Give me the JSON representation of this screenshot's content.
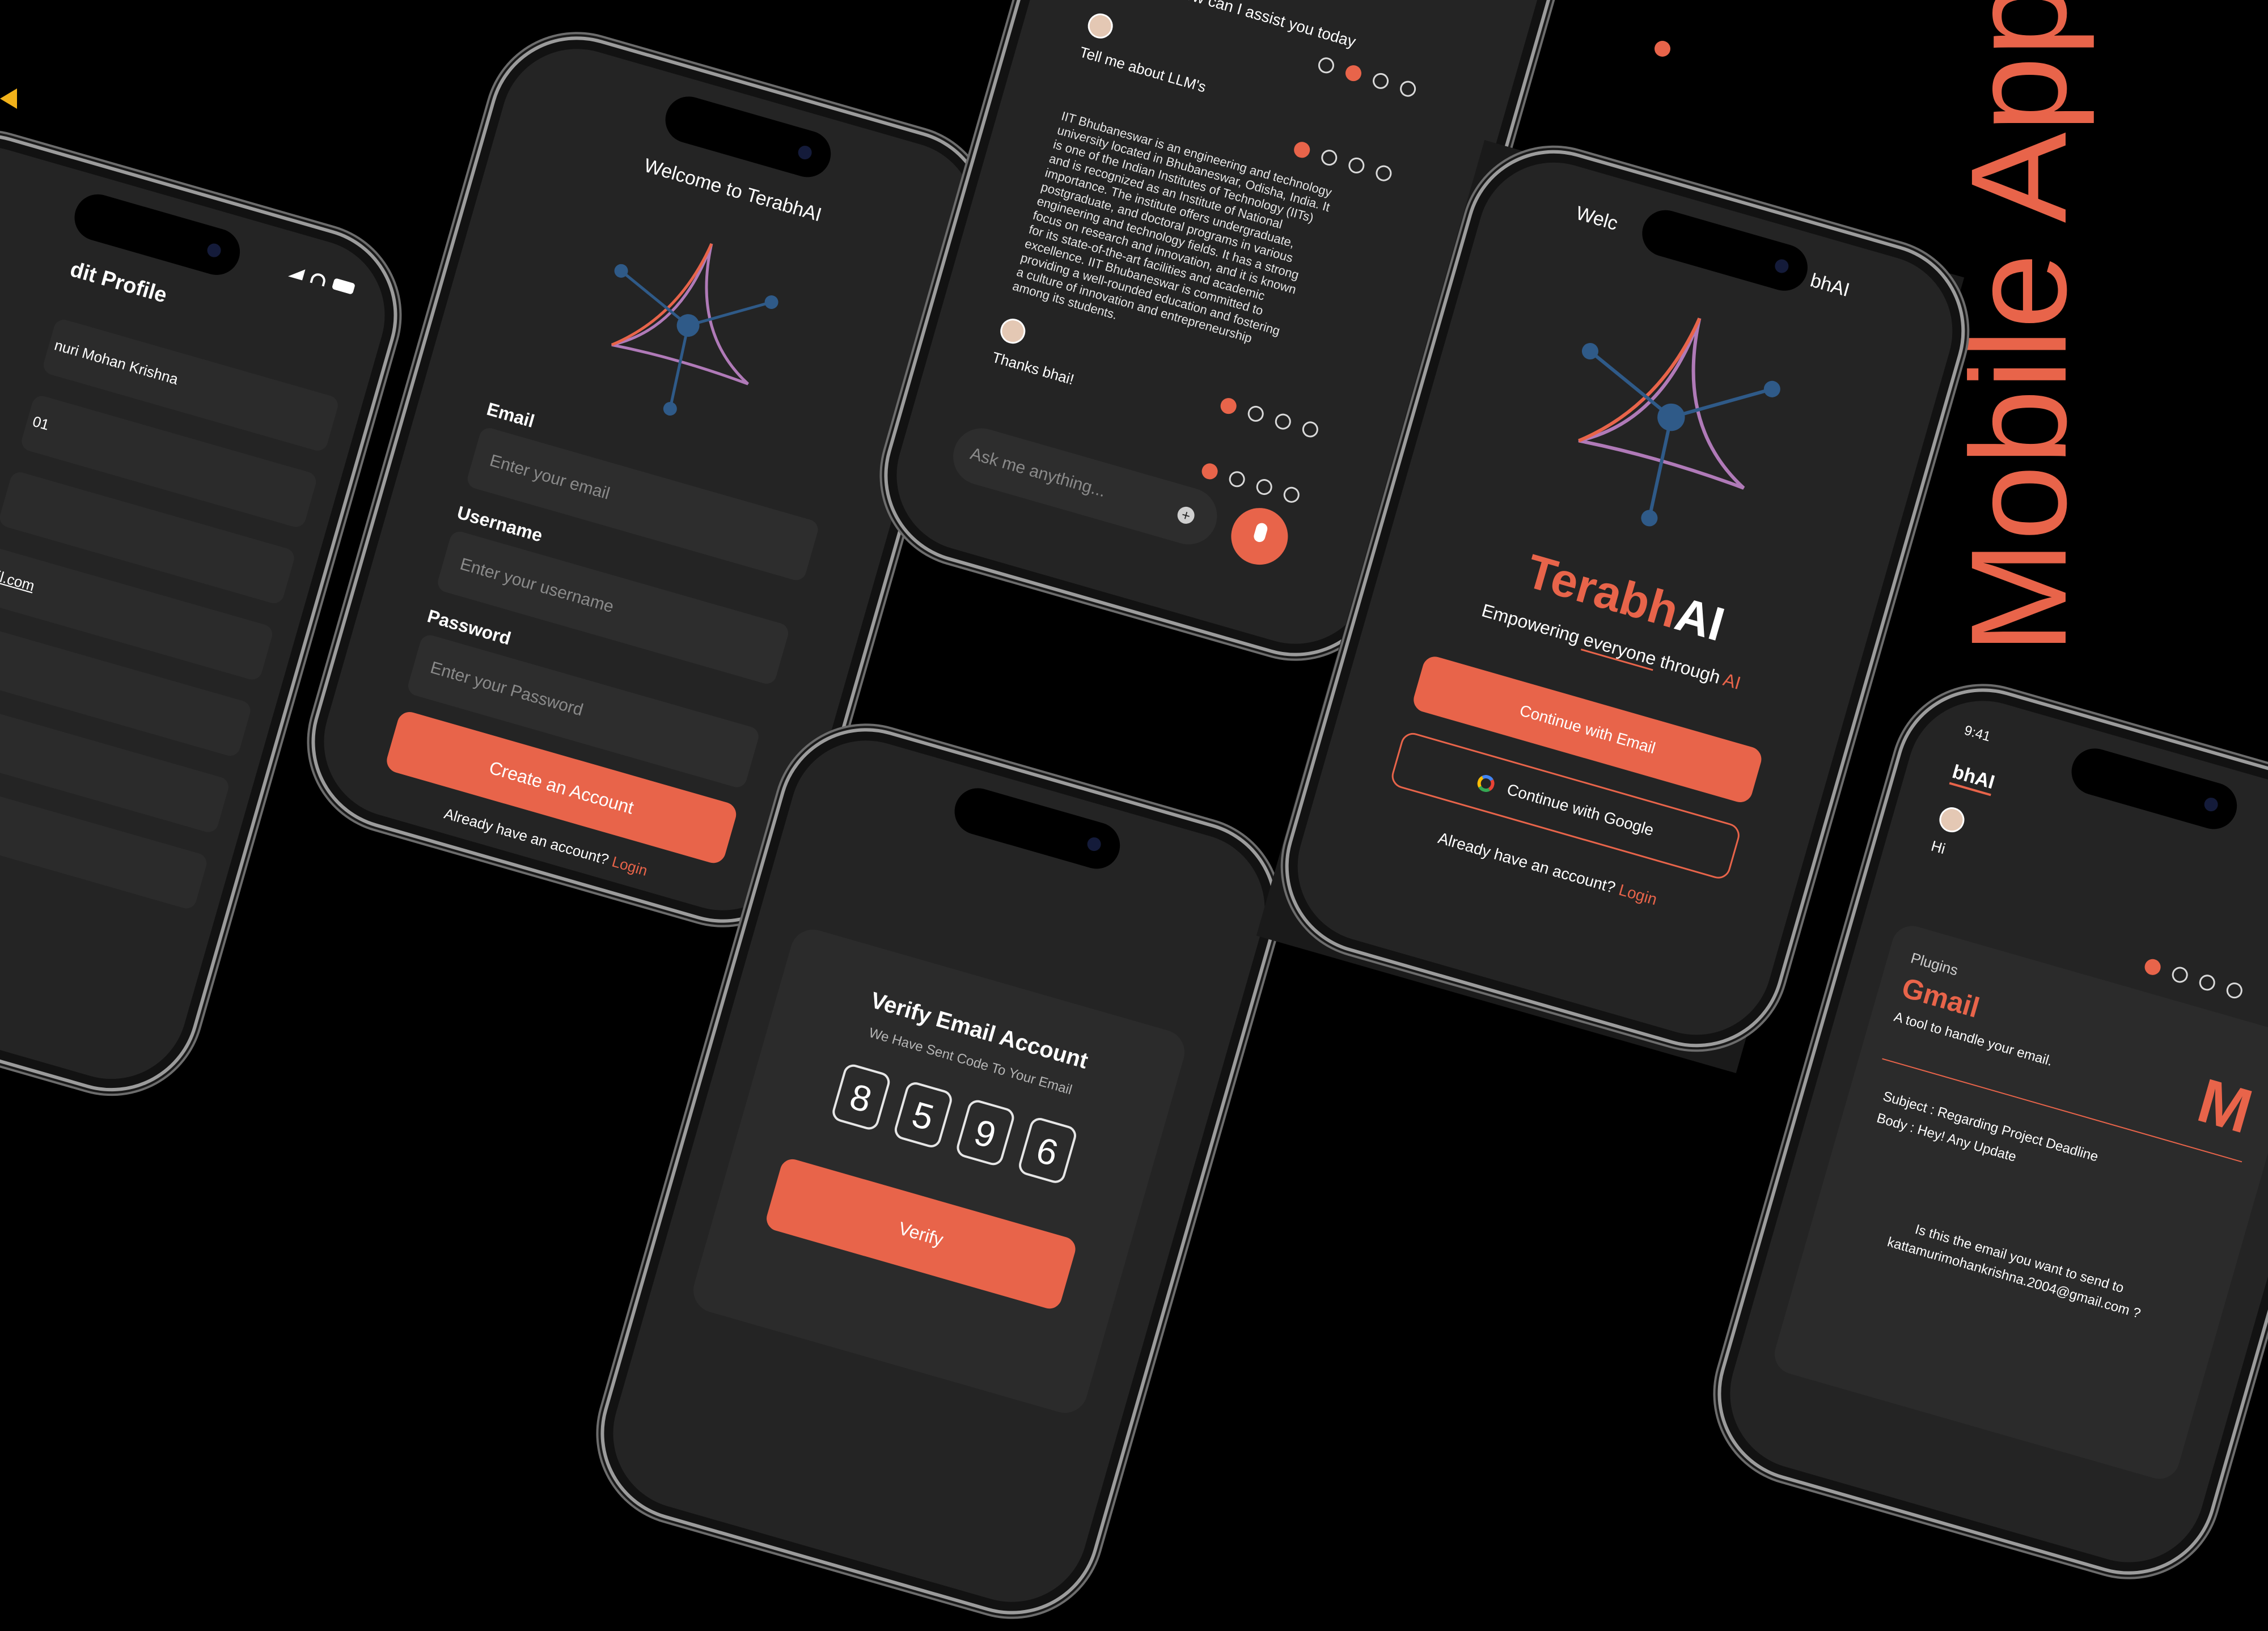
{
  "side_title": "Mobile App",
  "colors": {
    "accent": "#e8644a",
    "background": "#000000",
    "screen": "#242424",
    "field": "#2d2d2d"
  },
  "profile": {
    "title": "dit Profile",
    "name_value": "nuri Mohan Krishna",
    "field2_value": "01",
    "email_value": "ail.com",
    "status": {
      "signal_icon": "signal-icon",
      "wifi_icon": "wifi-icon",
      "battery_icon": "battery-icon"
    }
  },
  "signup": {
    "title": "Welcome to TerabhAI",
    "email_label": "Email",
    "email_placeholder": "Enter your email",
    "username_label": "Username",
    "username_placeholder": "Enter your username",
    "password_label": "Password",
    "password_placeholder": "Enter your  Password",
    "create_button": "Create an Account",
    "already": "Already have an account?",
    "login_link": "Login"
  },
  "chat": {
    "assistant_greeting": "Hey Bhai, How can I assist you today",
    "user_msg1": "Tell me about LLM's",
    "assistant_answer": [
      "IIT Bhubaneswar is an engineering and technology",
      "university located in Bhubaneswar, Odisha, India. It",
      "is one of the Indian Institutes of Technology (IITs)",
      "and is recognized as an Institute of National",
      "importance. The institute offers undergraduate,",
      "postgraduate, and doctoral programs in various",
      "engineering and technology fields. It has a strong",
      "focus on research and innovation, and it is known",
      "for its state-of-the-art facilities and academic",
      "excellence. IIT Bhubaneswar is committed to",
      "providing a well-rounded education and fostering",
      "a culture of innovation and entrepreneurship",
      "among its students."
    ],
    "user_msg2": "Thanks bhai!",
    "input_placeholder": "Ask me anything...",
    "add_icon": "plus-icon",
    "mic_icon": "mic-icon"
  },
  "verify": {
    "title": "Verify Email Account",
    "subtitle": "We Have Sent Code To Your Email",
    "digits": [
      "8",
      "5",
      "9",
      "6"
    ],
    "button": "Verify"
  },
  "welcome": {
    "title_left": "Welc",
    "title_right": "bhAI",
    "brand_main": "Terabh",
    "brand_ai": "AI",
    "tagline_pre": "Empowering ",
    "tagline_mid": "everyone",
    "tagline_post": " through ",
    "tagline_ai": "AI",
    "email_button": "Continue with Email",
    "google_button": "Continue with Google",
    "already": "Already have an account?",
    "login_link": "Login"
  },
  "plugin": {
    "time": "9:41",
    "app_title": "bhAI",
    "user_msg": "Hi",
    "section": "Plugins",
    "plugin_name": "Gmail",
    "plugin_desc": "A tool to handle your email.",
    "subject": "Subject : Regarding Project Deadline",
    "body": "Body : Hey! Any Update",
    "question_l1": "Is this the email you want to send to",
    "question_l2": "kattamurimohankrishna.2004@gmail.com ?"
  }
}
